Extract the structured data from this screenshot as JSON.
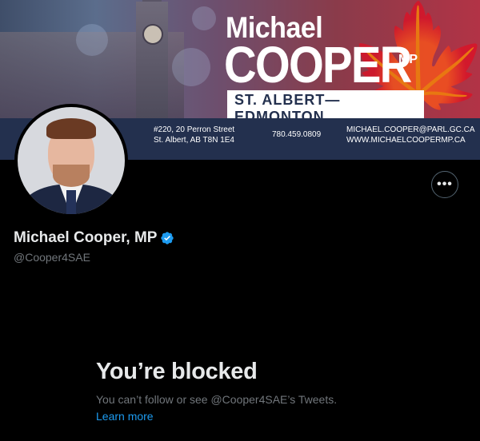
{
  "banner": {
    "first_name": "Michael",
    "last_name": "COOPER",
    "suffix": "MP",
    "riding": "ST. ALBERT—EDMONTON",
    "address_line1": "#220, 20 Perron Street",
    "address_line2": "St. Albert, AB T8N 1E4",
    "phone": "780.459.0809",
    "email": "MICHAEL.COOPER@PARL.GC.CA",
    "website": "WWW.MICHAELCOOPERMP.CA"
  },
  "profile": {
    "display_name": "Michael Cooper, MP",
    "handle": "@Cooper4SAE",
    "verified_icon": "verified-badge-icon",
    "more_icon": "more-options-icon",
    "more_label": "•••"
  },
  "blocked": {
    "title": "You’re blocked",
    "description": "You can’t follow or see @Cooper4SAE’s Tweets.",
    "learn_more": "Learn more"
  },
  "colors": {
    "background": "#000000",
    "text_primary": "#e7e9ea",
    "text_secondary": "#71767b",
    "link": "#1d9bf0",
    "verified": "#1d9bf0"
  }
}
